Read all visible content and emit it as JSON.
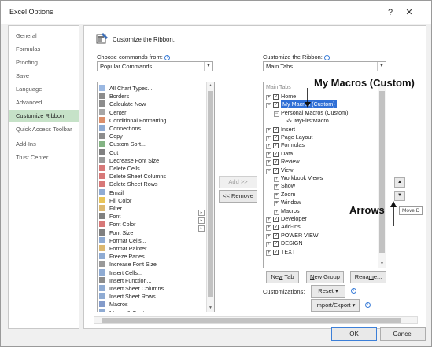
{
  "window": {
    "title": "Excel Options",
    "help_glyph": "?",
    "close_glyph": "✕"
  },
  "left_nav": [
    {
      "label": "General",
      "active": false
    },
    {
      "label": "Formulas",
      "active": false
    },
    {
      "label": "Proofing",
      "active": false
    },
    {
      "label": "Save",
      "active": false
    },
    {
      "label": "Language",
      "active": false
    },
    {
      "label": "Advanced",
      "active": false
    },
    {
      "label": "Customize Ribbon",
      "active": true
    },
    {
      "label": "Quick Access Toolbar",
      "active": false
    },
    {
      "label": "Add-Ins",
      "active": false
    },
    {
      "label": "Trust Center",
      "active": false
    }
  ],
  "header": {
    "title": "Customize the Ribbon."
  },
  "choose": {
    "label_underlined": "C",
    "label_rest": "hoose commands from:",
    "selected": "Popular Commands"
  },
  "customize": {
    "label_prefix": "Customize the Ri",
    "label_underlined": "b",
    "label_rest": "bon:",
    "selected": "Main Tabs"
  },
  "commands": [
    "All Chart Types...",
    "Borders",
    "Calculate Now",
    "Center",
    "Conditional Formatting",
    "Connections",
    "Copy",
    "Custom Sort...",
    "Cut",
    "Decrease Font Size",
    "Delete Cells...",
    "Delete Sheet Columns",
    "Delete Sheet Rows",
    "Email",
    "Fill Color",
    "Filter",
    "Font",
    "Font Color",
    "Font Size",
    "Format Cells...",
    "Format Painter",
    "Freeze Panes",
    "Increase Font Size",
    "Insert Cells...",
    "Insert Function...",
    "Insert Sheet Columns",
    "Insert Sheet Rows",
    "Macros",
    "Merge & Center"
  ],
  "tree": {
    "header": "Main Tabs",
    "rows": [
      {
        "label": "Home",
        "level": 0,
        "expander": "+",
        "checkbox": true,
        "selected": false
      },
      {
        "label": "My Macros (Custom)",
        "level": 0,
        "expander": "−",
        "checkbox": true,
        "selected": true
      },
      {
        "label": "Personal Macros (Custom)",
        "level": 1,
        "expander": "−",
        "checkbox": false,
        "selected": false
      },
      {
        "label": "MyFirstMacro",
        "level": 2,
        "expander": "",
        "checkbox": false,
        "selected": false
      },
      {
        "label": "Insert",
        "level": 0,
        "expander": "+",
        "checkbox": true,
        "selected": false
      },
      {
        "label": "Page Layout",
        "level": 0,
        "expander": "+",
        "checkbox": true,
        "selected": false
      },
      {
        "label": "Formulas",
        "level": 0,
        "expander": "+",
        "checkbox": true,
        "selected": false
      },
      {
        "label": "Data",
        "level": 0,
        "expander": "+",
        "checkbox": true,
        "selected": false
      },
      {
        "label": "Review",
        "level": 0,
        "expander": "+",
        "checkbox": true,
        "selected": false
      },
      {
        "label": "View",
        "level": 0,
        "expander": "−",
        "checkbox": true,
        "selected": false
      },
      {
        "label": "Workbook Views",
        "level": 1,
        "expander": "+",
        "checkbox": false,
        "selected": false
      },
      {
        "label": "Show",
        "level": 1,
        "expander": "+",
        "checkbox": false,
        "selected": false
      },
      {
        "label": "Zoom",
        "level": 1,
        "expander": "+",
        "checkbox": false,
        "selected": false
      },
      {
        "label": "Window",
        "level": 1,
        "expander": "+",
        "checkbox": false,
        "selected": false
      },
      {
        "label": "Macros",
        "level": 1,
        "expander": "+",
        "checkbox": false,
        "selected": false
      },
      {
        "label": "Developer",
        "level": 0,
        "expander": "+",
        "checkbox": true,
        "selected": false
      },
      {
        "label": "Add-Ins",
        "level": 0,
        "expander": "+",
        "checkbox": true,
        "selected": false
      },
      {
        "label": "POWER VIEW",
        "level": 0,
        "expander": "+",
        "checkbox": true,
        "selected": false
      },
      {
        "label": "DESIGN",
        "level": 0,
        "expander": "+",
        "checkbox": true,
        "selected": false
      },
      {
        "label": "TEXT",
        "level": 0,
        "expander": "+",
        "checkbox": true,
        "selected": false
      }
    ]
  },
  "buttons": {
    "add": "Add >>",
    "remove_prefix": "<< ",
    "remove_underlined": "R",
    "remove_rest": "emove",
    "new_tab_prefix": "Ne",
    "new_tab_underlined": "w",
    "new_tab_rest": " Tab",
    "new_group_underlined": "N",
    "new_group_rest": "ew Group",
    "rename_prefix": "Rena",
    "rename_underlined": "m",
    "rename_rest": "e...",
    "customizations_label": "Customizations:",
    "reset_prefix": "R",
    "reset_underlined": "e",
    "reset_rest": "set ▾",
    "import_export": "Import/Export ▾",
    "ok": "OK",
    "cancel": "Cancel",
    "move_up": "▲",
    "move_down": "▼"
  },
  "tooltip": "Move D",
  "annotations": {
    "macros_label": "My Macros (Custom)",
    "arrows_label": "Arrows"
  },
  "colors": {
    "selection": "#2f6fd6",
    "nav_active": "#c6e2c8"
  }
}
